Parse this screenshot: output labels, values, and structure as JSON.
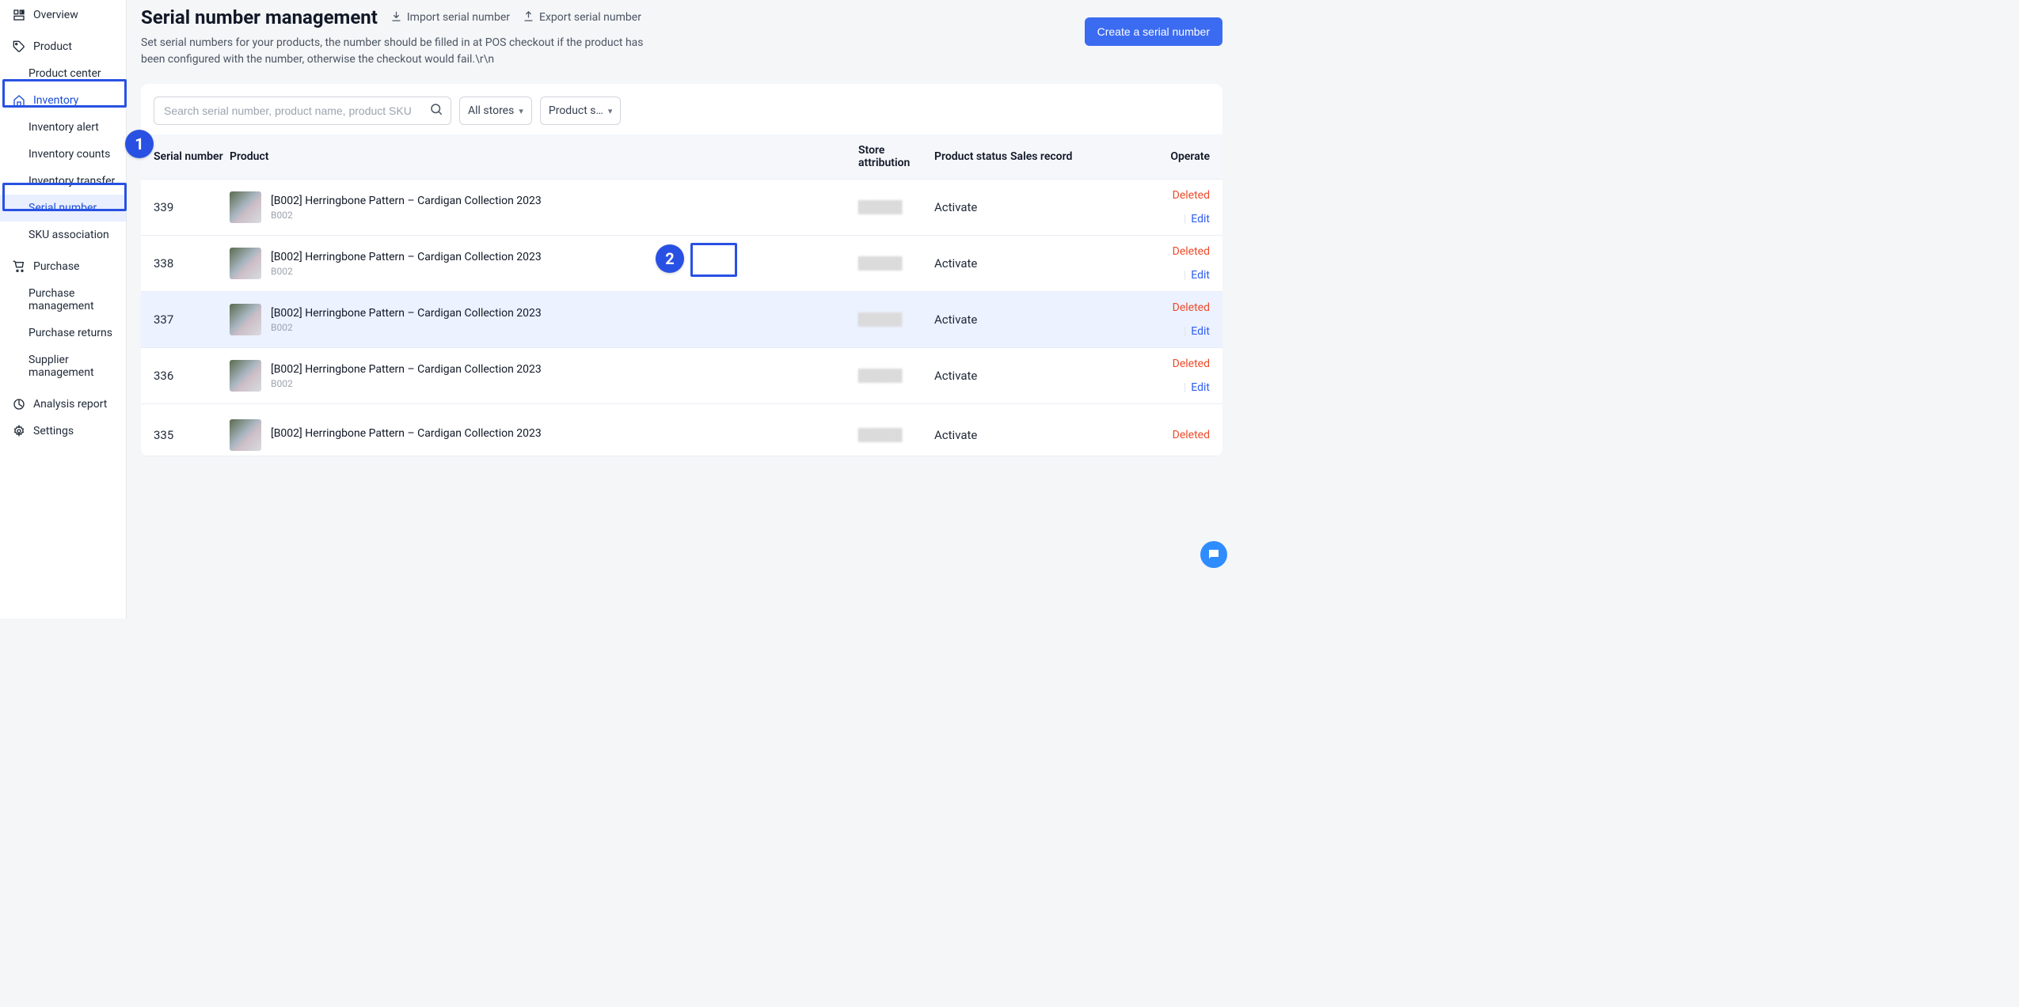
{
  "sidebar": {
    "overview": "Overview",
    "product": "Product",
    "product_center": "Product center",
    "inventory": "Inventory",
    "inventory_alert": "Inventory alert",
    "inventory_counts": "Inventory counts",
    "inventory_transfer": "Inventory transfer",
    "serial_number": "Serial number",
    "sku_association": "SKU association",
    "purchase": "Purchase",
    "purchase_management": "Purchase management",
    "purchase_returns": "Purchase returns",
    "supplier_management": "Supplier management",
    "analysis_report": "Analysis report",
    "settings": "Settings"
  },
  "header": {
    "title": "Serial number management",
    "import": "Import serial number",
    "export": "Export serial number",
    "subtitle": "Set serial numbers for your products, the number should be filled in at POS checkout if the product has been configured with the number, otherwise the checkout would fail.\\r\\n",
    "create": "Create a serial number"
  },
  "filters": {
    "search_placeholder": "Search serial number, product name, product SKU",
    "stores": "All stores",
    "product_status": "Product s…"
  },
  "table": {
    "cols": {
      "serial": "Serial number",
      "product": "Product",
      "store": "Store attribution",
      "status": "Product status",
      "sales": "Sales record",
      "operate": "Operate"
    },
    "deleted_label": "Deleted",
    "edit_label": "Edit",
    "rows": [
      {
        "serial": "339",
        "name": "[B002] Herringbone Pattern – Cardigan Collection 2023",
        "sku": "B002",
        "status": "Activate"
      },
      {
        "serial": "338",
        "name": "[B002] Herringbone Pattern – Cardigan Collection 2023",
        "sku": "B002",
        "status": "Activate"
      },
      {
        "serial": "337",
        "name": "[B002] Herringbone Pattern – Cardigan Collection 2023",
        "sku": "B002",
        "status": "Activate"
      },
      {
        "serial": "336",
        "name": "[B002] Herringbone Pattern – Cardigan Collection 2023",
        "sku": "B002",
        "status": "Activate"
      },
      {
        "serial": "335",
        "name": "[B002] Herringbone Pattern – Cardigan Collection 2023",
        "sku": "",
        "status": "Activate"
      }
    ]
  },
  "annotations": {
    "badge1": "1",
    "badge2": "2"
  }
}
